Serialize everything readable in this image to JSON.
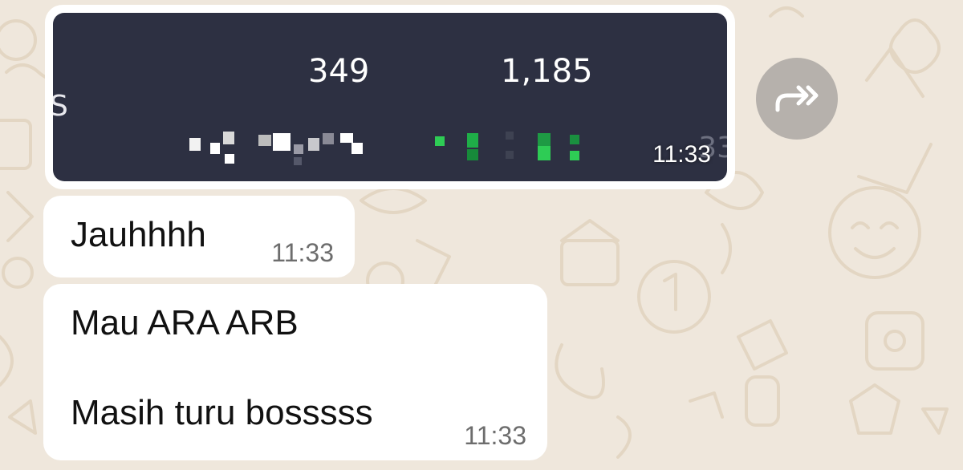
{
  "image_message": {
    "value_1": "349",
    "value_2": "1,185",
    "edge_letter": "S",
    "edge_digits": "33",
    "time": "11:33"
  },
  "forward_button": {
    "icon": "forward-icon",
    "color": "#b6b1ac"
  },
  "messages": [
    {
      "lines": [
        "Jauhhhh"
      ],
      "time": "11:33"
    },
    {
      "lines": [
        "Mau ARA ARB",
        "Masih turu bosssss"
      ],
      "time": "11:33"
    }
  ],
  "colors": {
    "background": "#efe7dc",
    "bubble": "#ffffff",
    "image_bg": "#2d3042",
    "green": "#2ecc55"
  }
}
